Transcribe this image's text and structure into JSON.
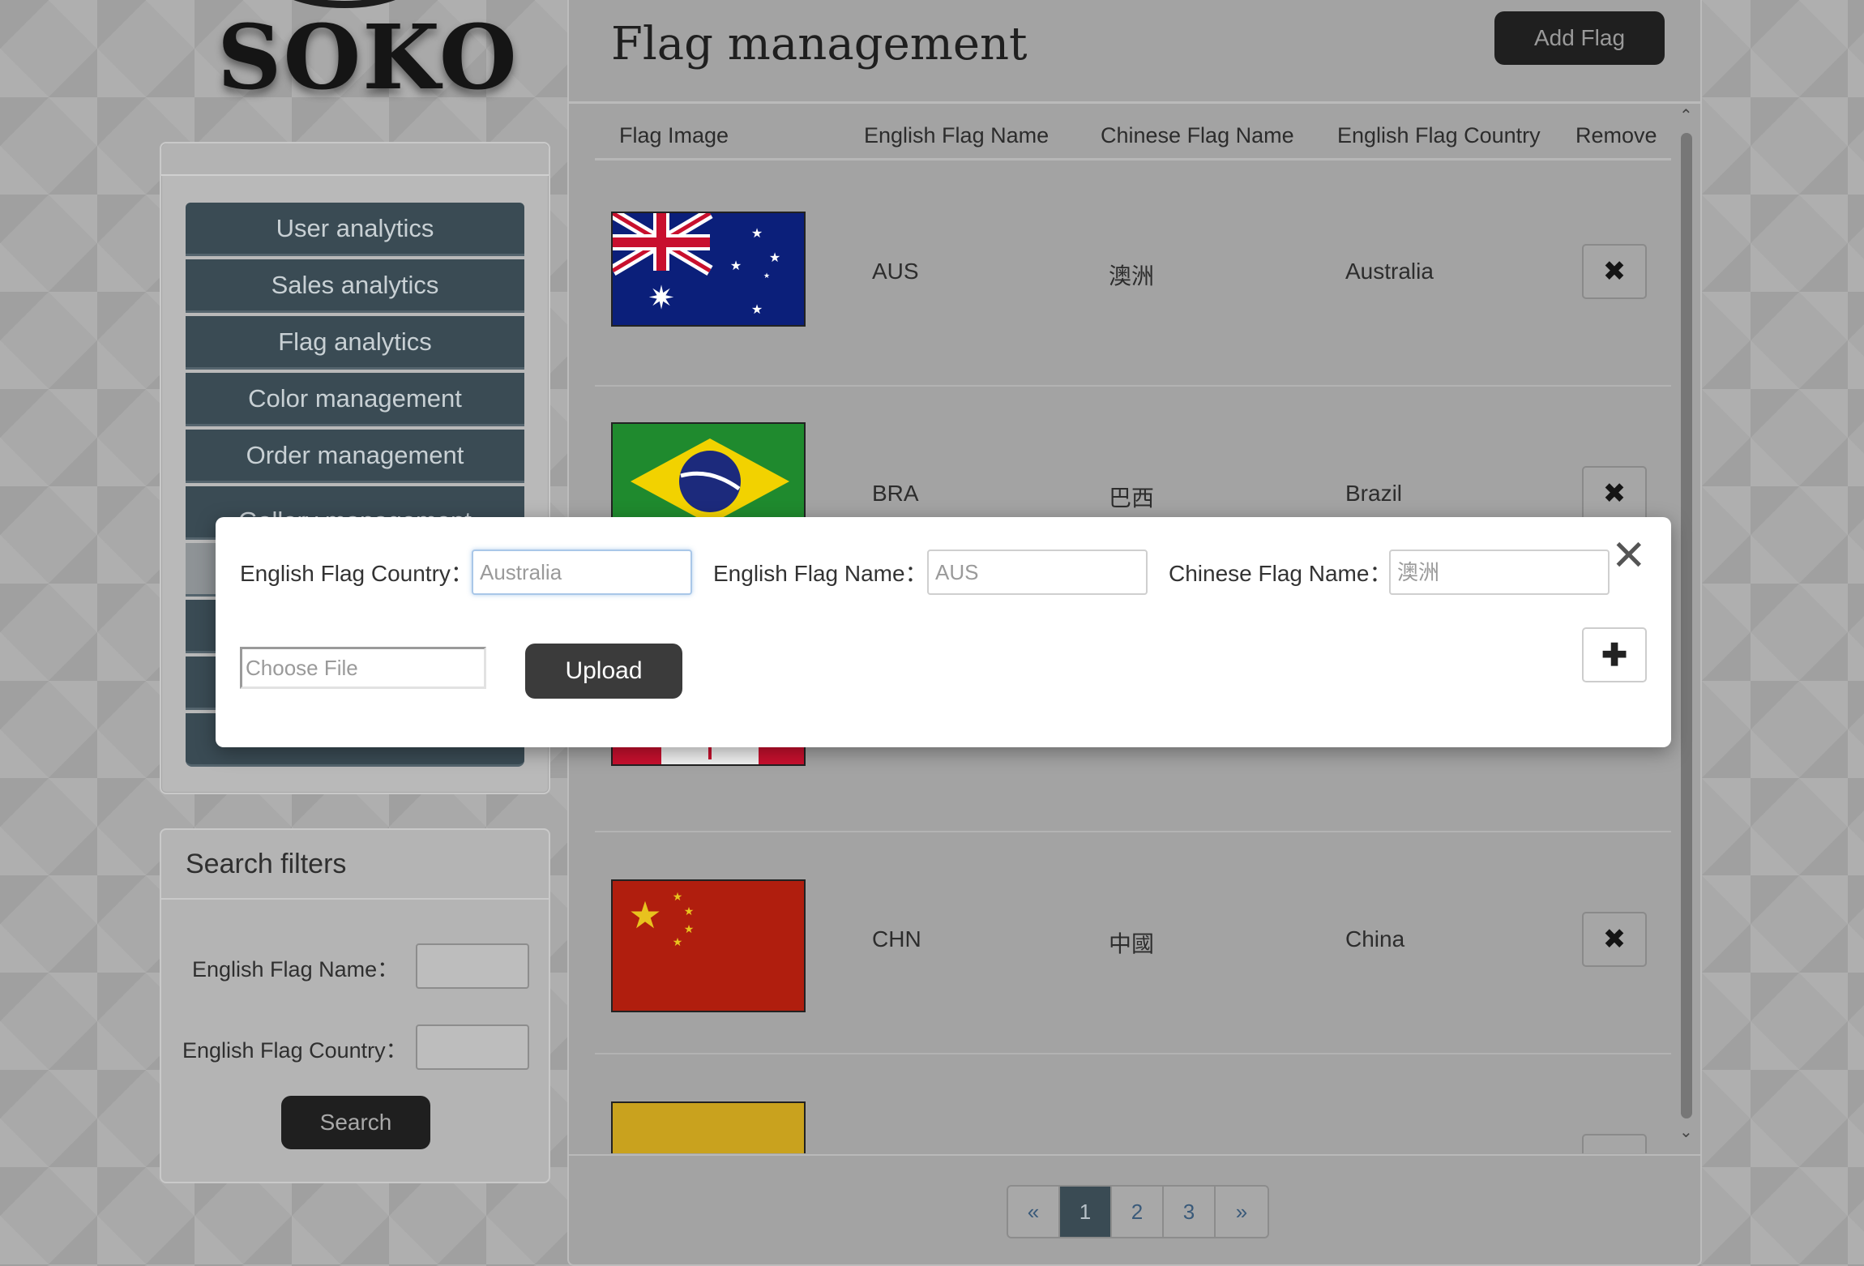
{
  "app": {
    "logo": "SOKO"
  },
  "sidebar": {
    "nav_items": [
      {
        "label": "User analytics"
      },
      {
        "label": "Sales analytics"
      },
      {
        "label": "Flag analytics"
      },
      {
        "label": "Color management"
      },
      {
        "label": "Order management"
      },
      {
        "label": "Gallery management"
      }
    ]
  },
  "filters": {
    "title": "Search filters",
    "english_flag_name_label": "English Flag Name：",
    "english_flag_name_value": "",
    "english_flag_country_label": "English Flag Country：",
    "english_flag_country_value": "",
    "search_label": "Search"
  },
  "main": {
    "title": "Flag management",
    "add_button": "Add Flag",
    "columns": [
      "Flag Image",
      "English Flag Name",
      "Chinese Flag Name",
      "English Flag Country",
      "Remove"
    ],
    "rows": [
      {
        "flag_icon": "australia-flag",
        "english_name": "AUS",
        "chinese_name": "澳洲",
        "country": "Australia"
      },
      {
        "flag_icon": "brazil-flag",
        "english_name": "BRA",
        "chinese_name": "巴西",
        "country": "Brazil"
      },
      {
        "flag_icon": "canada-flag",
        "english_name": "",
        "chinese_name": "",
        "country": ""
      },
      {
        "flag_icon": "china-flag",
        "english_name": "CHN",
        "chinese_name": "中國",
        "country": "China"
      },
      {
        "flag_icon": "yellow-flag",
        "english_name": "",
        "chinese_name": "",
        "country": ""
      }
    ],
    "remove_icon": "✖"
  },
  "pagination": {
    "prev": "«",
    "pages": [
      "1",
      "2",
      "3"
    ],
    "current": "1",
    "next": "»"
  },
  "modal": {
    "country_label": "English Flag Country：",
    "country_placeholder": "Australia",
    "name_label": "English Flag Name：",
    "name_placeholder": "AUS",
    "chinese_label": "Chinese Flag Name：",
    "chinese_placeholder": "澳洲",
    "file_placeholder": "Choose File",
    "upload_label": "Upload",
    "close_icon": "✕",
    "add_icon": "✚"
  }
}
